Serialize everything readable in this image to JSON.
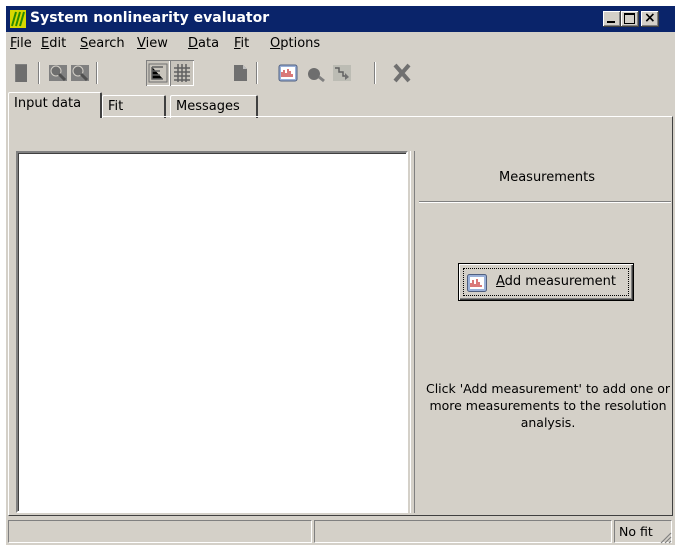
{
  "window": {
    "title": "System nonlinearity evaluator",
    "title_bar_color": "#0a246a",
    "face_color": "#d4d0c8",
    "close_glyph": "×"
  },
  "menu": [
    "File",
    "Edit",
    "Search",
    "View",
    "Data",
    "Fit",
    "Options"
  ],
  "toolbar": {
    "buttons": [
      {
        "icon": "new-doc-icon",
        "state": "disabled"
      },
      {
        "icon": "zoom-in-icon",
        "state": "disabled"
      },
      {
        "icon": "zoom-out-icon",
        "state": "disabled"
      },
      {
        "icon": "tree-view-icon",
        "state": "pressed"
      },
      {
        "icon": "grid-view-icon",
        "state": "pressed"
      },
      {
        "icon": "page-icon",
        "state": "disabled"
      },
      {
        "icon": "measurement-chart-icon",
        "state": "enabled"
      },
      {
        "icon": "probe-icon",
        "state": "disabled"
      },
      {
        "icon": "step-icon",
        "state": "disabled"
      },
      {
        "icon": "delete-icon",
        "state": "disabled"
      }
    ]
  },
  "tabs": [
    {
      "label": "Input data",
      "selected": true
    },
    {
      "label": "Fit",
      "selected": false
    },
    {
      "label": "Messages",
      "selected": false
    }
  ],
  "measurements": {
    "title": "Measurements",
    "add_button_label": "Add measurement",
    "help_text": "Click 'Add measurement' to add one or more measurements to the resolution analysis."
  },
  "statusbar": {
    "pane1": "",
    "pane2": "",
    "pane3": "No fit"
  }
}
